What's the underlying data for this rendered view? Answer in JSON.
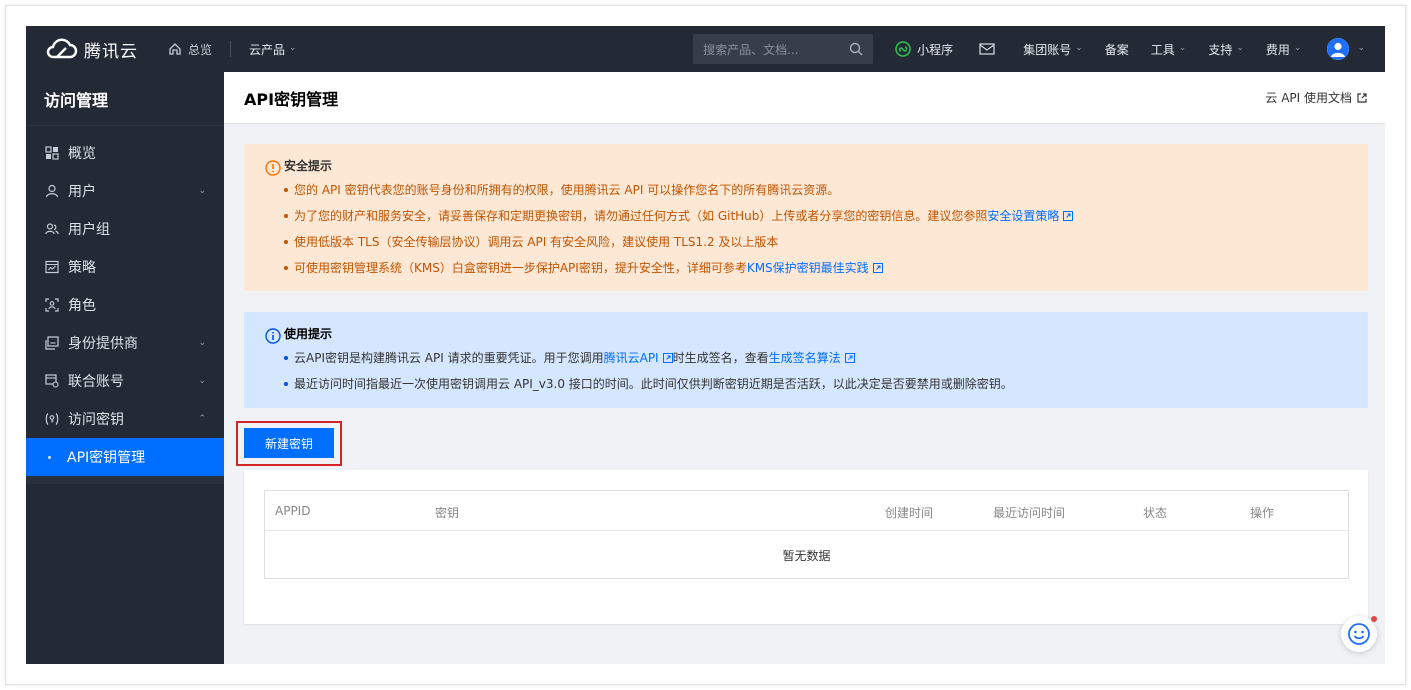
{
  "topbar": {
    "brand": "腾讯云",
    "overview": "总览",
    "products": "云产品",
    "search_placeholder": "搜索产品、文档...",
    "mini_program": "小程序",
    "group_account": "集团账号",
    "filing": "备案",
    "tools": "工具",
    "support": "支持",
    "billing": "费用"
  },
  "sidebar": {
    "title": "访问管理",
    "items": [
      {
        "label": "概览",
        "icon": "grid-icon"
      },
      {
        "label": "用户",
        "icon": "user-icon"
      },
      {
        "label": "用户组",
        "icon": "users-icon"
      },
      {
        "label": "策略",
        "icon": "policy-icon"
      },
      {
        "label": "角色",
        "icon": "role-icon"
      },
      {
        "label": "身份提供商",
        "icon": "idp-icon"
      },
      {
        "label": "联合账号",
        "icon": "federated-icon"
      },
      {
        "label": "访问密钥",
        "icon": "key-icon"
      },
      {
        "label": "API密钥管理",
        "icon": "dot"
      }
    ]
  },
  "page": {
    "title": "API密钥管理",
    "doc_link": "云 API 使用文档"
  },
  "security_alert": {
    "title": "安全提示",
    "line1": "您的 API 密钥代表您的账号身份和所拥有的权限，使用腾讯云 API 可以操作您名下的所有腾讯云资源。",
    "line2_text": "为了您的财产和服务安全，请妥善保存和定期更换密钥，请勿通过任何方式（如 GitHub）上传或者分享您的密钥信息。建议您参照",
    "line2_link": "安全设置策略",
    "line3": "使用低版本 TLS（安全传输层协议）调用云 API 有安全风险，建议使用 TLS1.2 及以上版本",
    "line4_text": "可使用密钥管理系统（KMS）白盒密钥进一步保护API密钥，提升安全性，详细可参考",
    "line4_link": "KMS保护密钥最佳实践"
  },
  "usage_alert": {
    "title": "使用提示",
    "line1_text_a": "云API密钥是构建腾讯云 API 请求的重要凭证。用于您调用",
    "line1_link_a": "腾讯云API",
    "line1_text_b": "时生成签名，查看",
    "line1_link_b": "生成签名算法",
    "line2": "最近访问时间指最近一次使用密钥调用云 API_v3.0 接口的时间。此时间仅供判断密钥近期是否活跃，以此决定是否要禁用或删除密钥。"
  },
  "create_button": "新建密钥",
  "table": {
    "columns": [
      "APPID",
      "密钥",
      "创建时间",
      "最近访问时间",
      "状态",
      "操作"
    ],
    "empty_text": "暂无数据"
  },
  "colors": {
    "topbar_bg": "#232a35",
    "primary": "#006eff",
    "warn_bg": "#fde8d6",
    "info_bg": "#d5e7fe",
    "highlight_border": "#d5252a"
  }
}
